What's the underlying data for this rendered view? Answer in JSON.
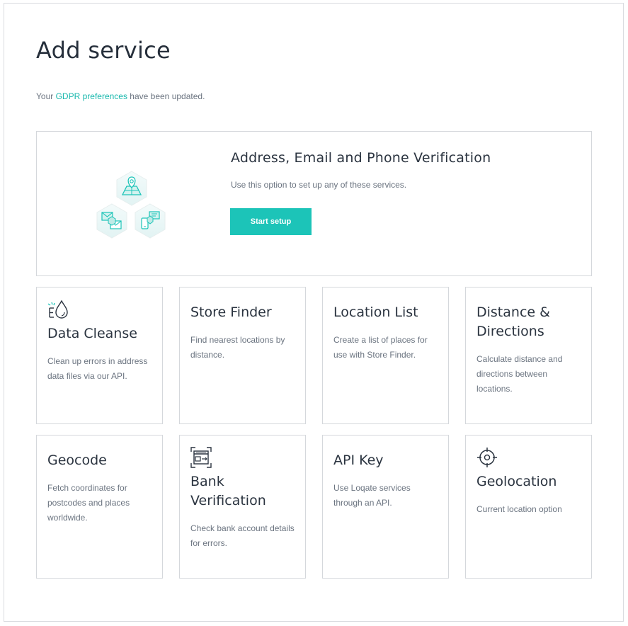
{
  "page": {
    "title": "Add service"
  },
  "gdpr": {
    "prefix": "Your ",
    "link_text": "GDPR preferences",
    "suffix": " have been updated."
  },
  "hero": {
    "title": "Address, Email and Phone Verification",
    "description": "Use this option to set up any of these services.",
    "button_label": "Start setup",
    "illustration": "map-email-phone-hexagon-icons"
  },
  "cards": [
    {
      "title": "Data Cleanse",
      "description": "Clean up errors in address data files via our API.",
      "icon": "droplet-sparkle-icon"
    },
    {
      "title": "Store Finder",
      "description": "Find nearest locations by distance."
    },
    {
      "title": "Location List",
      "description": "Create a list of places for use with Store Finder."
    },
    {
      "title": "Distance & Directions",
      "description": "Calculate distance and directions between locations."
    },
    {
      "title": "Geocode",
      "description": "Fetch coordinates for postcodes and places worldwide."
    },
    {
      "title": "Bank Verification",
      "description": "Check bank account details for errors.",
      "icon": "bank-card-scan-icon"
    },
    {
      "title": "API Key",
      "description": "Use Loqate services through an API."
    },
    {
      "title": "Geolocation",
      "description": "Current location option",
      "icon": "crosshair-target-icon"
    }
  ],
  "colors": {
    "accent": "#1cc4b8",
    "link": "#18b8ad",
    "text": "#2b3440",
    "muted": "#6b7480",
    "border": "#d5d8dc"
  }
}
